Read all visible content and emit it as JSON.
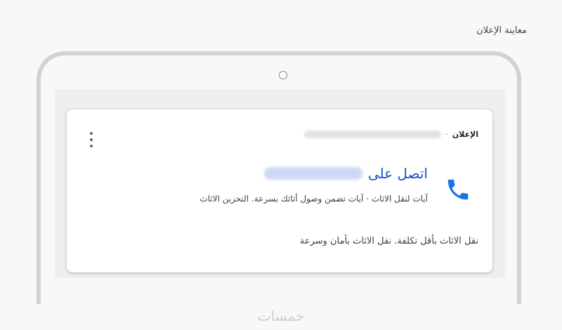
{
  "preview_title": "معاينة الإعلان",
  "ad": {
    "label": "الإعلان",
    "separator": "·",
    "headline_prefix": "اتصل على",
    "description": "آيات لنقل الاثاث · آيات تضمن وصول أثاثك بسرعة. التخزين الاثاث",
    "tagline": "نقل الاثاث بأقل تكلفة. نقل الاثاث بأمان وسرعة"
  },
  "icons": {
    "call": "phone-icon",
    "menu": "more-vert-icon"
  },
  "colors": {
    "headline": "#1a4fd0",
    "call_icon": "#1a73e8"
  },
  "watermark": "خمسات"
}
